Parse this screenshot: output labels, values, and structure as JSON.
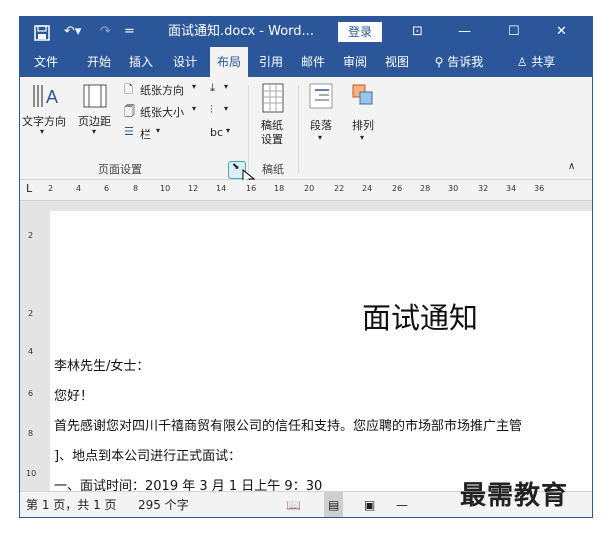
{
  "titlebar": {
    "doc_title": "面试通知.docx - Word...",
    "login_button": "登录",
    "dropdown_glyph": "=",
    "ribbon_display_glyph": "⊡",
    "minimize_glyph": "—",
    "maximize_glyph": "☐",
    "close_glyph": "✕"
  },
  "tabs": [
    {
      "label": "文件"
    },
    {
      "label": "开始"
    },
    {
      "label": "插入"
    },
    {
      "label": "设计"
    },
    {
      "label": "布局"
    },
    {
      "label": "引用"
    },
    {
      "label": "邮件"
    },
    {
      "label": "审阅"
    },
    {
      "label": "视图"
    },
    {
      "label": "告诉我"
    },
    {
      "label": "共享"
    }
  ],
  "ribbon": {
    "text_direction": "文字方向",
    "margins": "页边距",
    "orientation": "纸张方向",
    "size": "纸张大小",
    "columns": "栏",
    "hyphen_mark": "bc",
    "manuscript_settings_line1": "稿纸",
    "manuscript_settings_line2": "设置",
    "arrange_paragraph": "段落",
    "arrange": "排列",
    "group_page_setup": "页面设置",
    "group_manuscript": "稿纸"
  },
  "ruler": {
    "corner": "L",
    "numbers": [
      "2",
      "4",
      "6",
      "8",
      "10",
      "12",
      "14",
      "16",
      "18",
      "20",
      "22",
      "24",
      "26",
      "28",
      "30",
      "32",
      "34",
      "36"
    ],
    "vertical_numbers": [
      "2",
      "2",
      "4",
      "6",
      "8",
      "10"
    ]
  },
  "document": {
    "title": "面试通知",
    "lines": [
      "李林先生/女士：",
      "您好！",
      "首先感谢您对四川千禧商贸有限公司的信任和支持。您应聘的市场部市场推广主管",
      "]、地点到本公司进行正式面试：",
      "一、面试时间：2019 年 3 月 1 日上午 9：30"
    ]
  },
  "statusbar": {
    "page_info": "第 1 页，共 1 页",
    "word_count": "295 个字"
  },
  "watermark": "最需教育",
  "colors": {
    "brand": "#2b579a",
    "ribbon_bg": "#f3f3f3"
  }
}
